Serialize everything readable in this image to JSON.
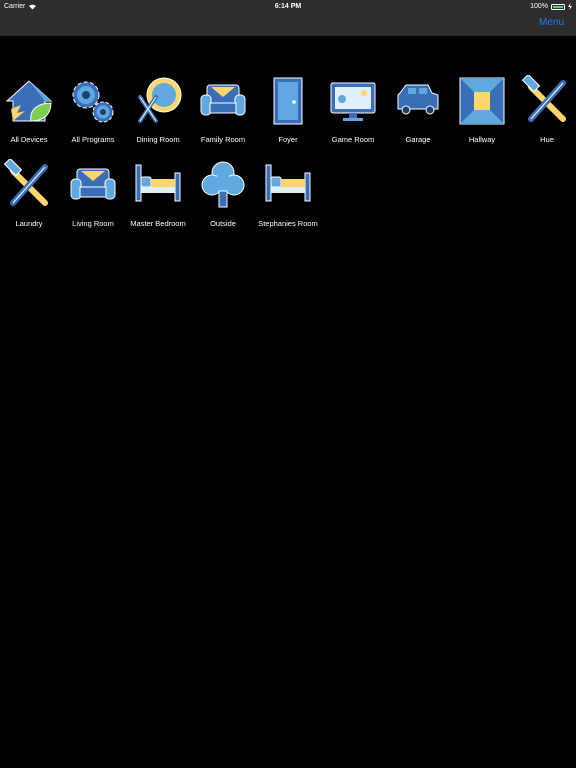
{
  "status_bar": {
    "carrier": "Carrier",
    "time": "6:14 PM",
    "battery": "100%",
    "battery_level": 1.0
  },
  "nav": {
    "menu_label": "Menu"
  },
  "accent": "#1e7cf2",
  "tiles": [
    {
      "label": "All Devices",
      "icon": "house-leaf-icon"
    },
    {
      "label": "All Programs",
      "icon": "gears-icon"
    },
    {
      "label": "Dining Room",
      "icon": "plate-utensils-icon"
    },
    {
      "label": "Family Room",
      "icon": "armchair-icon"
    },
    {
      "label": "Foyer",
      "icon": "door-icon"
    },
    {
      "label": "Game Room",
      "icon": "monitor-icon"
    },
    {
      "label": "Garage",
      "icon": "car-icon"
    },
    {
      "label": "Hallway",
      "icon": "hallway-icon"
    },
    {
      "label": "Hue",
      "icon": "tools-icon"
    },
    {
      "label": "Laundry",
      "icon": "tools-icon"
    },
    {
      "label": "Living Room",
      "icon": "armchair-icon"
    },
    {
      "label": "Master Bedroom",
      "icon": "bed-icon"
    },
    {
      "label": "Outside",
      "icon": "tree-icon"
    },
    {
      "label": "Stephanies Room",
      "icon": "bed-icon"
    }
  ]
}
